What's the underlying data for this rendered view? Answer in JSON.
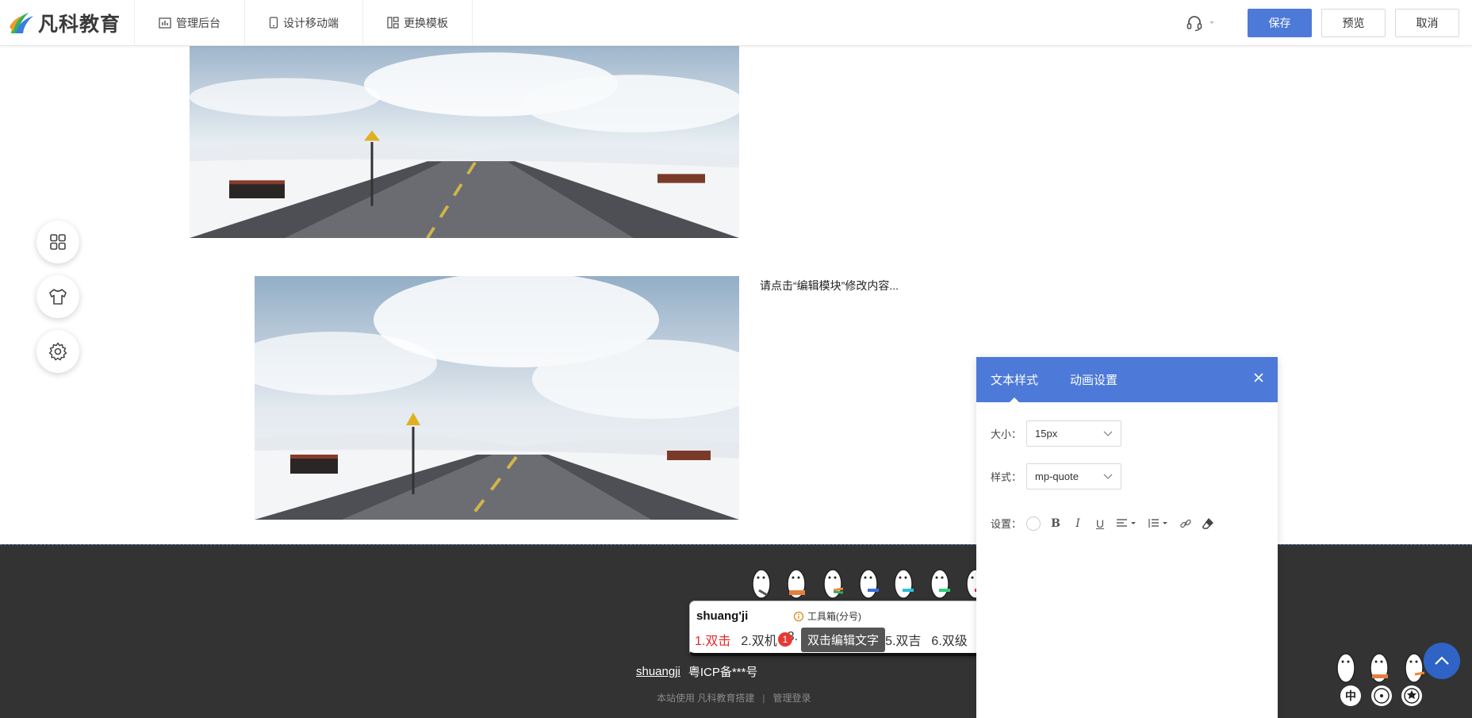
{
  "header": {
    "logo_text": "凡科教育",
    "nav": [
      {
        "label": "管理后台",
        "icon": "bar-chart-icon"
      },
      {
        "label": "设计移动端",
        "icon": "mobile-icon"
      },
      {
        "label": "更换模板",
        "icon": "template-icon"
      }
    ],
    "save_label": "保存",
    "preview_label": "预览",
    "cancel_label": "取消"
  },
  "content": {
    "caption": "请点击“编辑模块”修改内容..."
  },
  "floating_tools": [
    {
      "icon": "grid-apps-icon"
    },
    {
      "icon": "shirt-icon"
    },
    {
      "icon": "gear-icon"
    }
  ],
  "footer": {
    "ime_typed": "shuangji",
    "icp": "粤ICP备***号",
    "powered_by": "本站使用 凡科教育搭建",
    "admin_login": "管理登录"
  },
  "ime": {
    "input": "shuang'ji",
    "toolbox": "工具箱(分号)",
    "candidates": [
      "1.双击",
      "2.双机",
      "3.",
      "5.双吉",
      "6.双级"
    ],
    "tooltip": "双击编辑文字",
    "badge": "1"
  },
  "panel": {
    "tabs": [
      "文本样式",
      "动画设置"
    ],
    "size_label": "大小：",
    "size_value": "15px",
    "style_label": "样式：",
    "style_value": "mp-quote",
    "settings_label": "设置："
  },
  "bottom_widgets": {
    "zh": "中"
  },
  "colors": {
    "primary": "#4d7ad8",
    "footer_bg": "#333333",
    "backtop": "#2f63c6"
  }
}
